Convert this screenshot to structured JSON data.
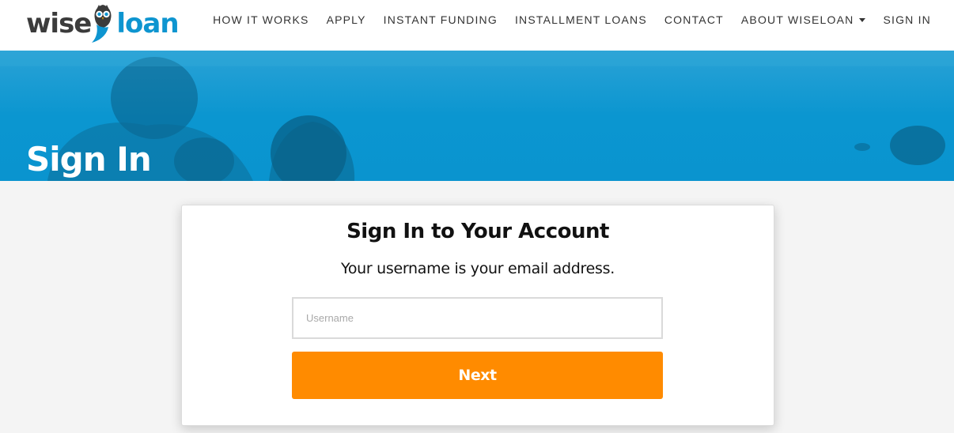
{
  "header": {
    "logo": {
      "wise": "wise",
      "loan": "loan"
    },
    "nav": [
      {
        "label": "HOW IT WORKS"
      },
      {
        "label": "APPLY"
      },
      {
        "label": "INSTANT FUNDING"
      },
      {
        "label": "INSTALLMENT LOANS"
      },
      {
        "label": "CONTACT"
      },
      {
        "label": "ABOUT WISELOAN",
        "dropdown": true
      },
      {
        "label": "SIGN IN"
      }
    ]
  },
  "hero": {
    "title": "Sign In",
    "color": "#0696d0"
  },
  "card": {
    "title": "Sign In to Your Account",
    "subtitle": "Your username is your email address.",
    "username_placeholder": "Username",
    "username_value": "",
    "next_label": "Next"
  },
  "colors": {
    "brand_blue": "#0e95d0",
    "brand_dark": "#3b3b3b",
    "button_orange": "#ff8b00"
  },
  "icons": {
    "logo_mark": "owl-icon",
    "dropdown": "caret-down-icon"
  }
}
